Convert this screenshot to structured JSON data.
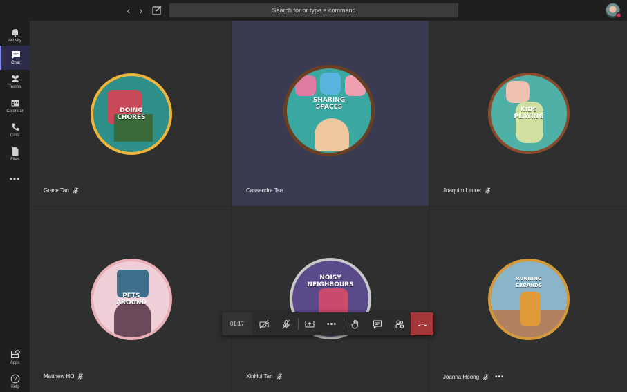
{
  "topbar": {
    "search_placeholder": "Search for or type a command",
    "back_glyph": "‹",
    "forward_glyph": "›"
  },
  "rail": {
    "items": [
      {
        "label": "Activity",
        "icon": "bell-icon"
      },
      {
        "label": "Chat",
        "icon": "chat-icon",
        "active": true
      },
      {
        "label": "Teams",
        "icon": "teams-icon"
      },
      {
        "label": "Calendar",
        "icon": "calendar-icon"
      },
      {
        "label": "Calls",
        "icon": "phone-icon"
      },
      {
        "label": "Files",
        "icon": "file-icon"
      }
    ],
    "more": "•••",
    "bottom": [
      {
        "label": "Apps",
        "icon": "apps-icon"
      },
      {
        "label": "Help",
        "icon": "help-icon"
      }
    ]
  },
  "participants": [
    {
      "name": "Grace Tan",
      "muted": true,
      "avatar_text": "DOING\nCHORES",
      "colors": [
        "#f0b43a",
        "#2f9089"
      ]
    },
    {
      "name": "Cassandra Tse",
      "muted": false,
      "avatar_text": "SHARING\nSPACES",
      "colors": [
        "#7a4a2a",
        "#3aa7a0"
      ]
    },
    {
      "name": "Joaquim Laurel",
      "muted": true,
      "avatar_text": "KIDS\nPLAYING",
      "colors": [
        "#a05a3a",
        "#4fb0a8"
      ]
    },
    {
      "name": "Matthew HO",
      "muted": true,
      "avatar_text": "PETS\nAROUND",
      "colors": [
        "#e9b0b8",
        "#3f6f8a"
      ]
    },
    {
      "name": "XinHui Tan",
      "muted": true,
      "avatar_text": "NOISY\nNEIGHBOURS",
      "colors": [
        "#c8c8c8",
        "#5a4a8a"
      ]
    },
    {
      "name": "Joanna Hoong",
      "muted": true,
      "avatar_text": "RUNNING\nERRANDS",
      "colors": [
        "#d49a3a",
        "#8ab4c8"
      ]
    }
  ],
  "controls": {
    "timer": "01:17",
    "more": "•••"
  }
}
